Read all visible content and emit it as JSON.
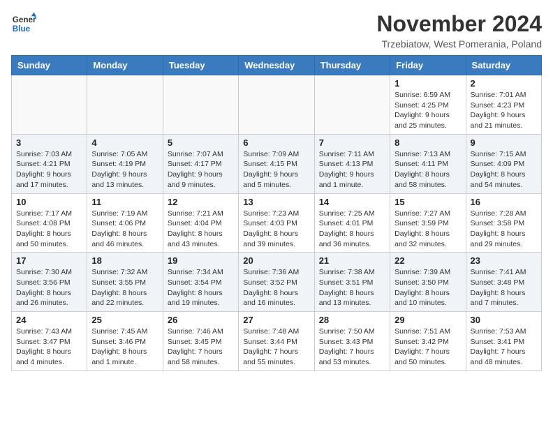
{
  "header": {
    "logo_line1": "General",
    "logo_line2": "Blue",
    "month_title": "November 2024",
    "subtitle": "Trzebiatow, West Pomerania, Poland"
  },
  "days_of_week": [
    "Sunday",
    "Monday",
    "Tuesday",
    "Wednesday",
    "Thursday",
    "Friday",
    "Saturday"
  ],
  "weeks": [
    [
      {
        "day": "",
        "info": ""
      },
      {
        "day": "",
        "info": ""
      },
      {
        "day": "",
        "info": ""
      },
      {
        "day": "",
        "info": ""
      },
      {
        "day": "",
        "info": ""
      },
      {
        "day": "1",
        "info": "Sunrise: 6:59 AM\nSunset: 4:25 PM\nDaylight: 9 hours\nand 25 minutes."
      },
      {
        "day": "2",
        "info": "Sunrise: 7:01 AM\nSunset: 4:23 PM\nDaylight: 9 hours\nand 21 minutes."
      }
    ],
    [
      {
        "day": "3",
        "info": "Sunrise: 7:03 AM\nSunset: 4:21 PM\nDaylight: 9 hours\nand 17 minutes."
      },
      {
        "day": "4",
        "info": "Sunrise: 7:05 AM\nSunset: 4:19 PM\nDaylight: 9 hours\nand 13 minutes."
      },
      {
        "day": "5",
        "info": "Sunrise: 7:07 AM\nSunset: 4:17 PM\nDaylight: 9 hours\nand 9 minutes."
      },
      {
        "day": "6",
        "info": "Sunrise: 7:09 AM\nSunset: 4:15 PM\nDaylight: 9 hours\nand 5 minutes."
      },
      {
        "day": "7",
        "info": "Sunrise: 7:11 AM\nSunset: 4:13 PM\nDaylight: 9 hours\nand 1 minute."
      },
      {
        "day": "8",
        "info": "Sunrise: 7:13 AM\nSunset: 4:11 PM\nDaylight: 8 hours\nand 58 minutes."
      },
      {
        "day": "9",
        "info": "Sunrise: 7:15 AM\nSunset: 4:09 PM\nDaylight: 8 hours\nand 54 minutes."
      }
    ],
    [
      {
        "day": "10",
        "info": "Sunrise: 7:17 AM\nSunset: 4:08 PM\nDaylight: 8 hours\nand 50 minutes."
      },
      {
        "day": "11",
        "info": "Sunrise: 7:19 AM\nSunset: 4:06 PM\nDaylight: 8 hours\nand 46 minutes."
      },
      {
        "day": "12",
        "info": "Sunrise: 7:21 AM\nSunset: 4:04 PM\nDaylight: 8 hours\nand 43 minutes."
      },
      {
        "day": "13",
        "info": "Sunrise: 7:23 AM\nSunset: 4:03 PM\nDaylight: 8 hours\nand 39 minutes."
      },
      {
        "day": "14",
        "info": "Sunrise: 7:25 AM\nSunset: 4:01 PM\nDaylight: 8 hours\nand 36 minutes."
      },
      {
        "day": "15",
        "info": "Sunrise: 7:27 AM\nSunset: 3:59 PM\nDaylight: 8 hours\nand 32 minutes."
      },
      {
        "day": "16",
        "info": "Sunrise: 7:28 AM\nSunset: 3:58 PM\nDaylight: 8 hours\nand 29 minutes."
      }
    ],
    [
      {
        "day": "17",
        "info": "Sunrise: 7:30 AM\nSunset: 3:56 PM\nDaylight: 8 hours\nand 26 minutes."
      },
      {
        "day": "18",
        "info": "Sunrise: 7:32 AM\nSunset: 3:55 PM\nDaylight: 8 hours\nand 22 minutes."
      },
      {
        "day": "19",
        "info": "Sunrise: 7:34 AM\nSunset: 3:54 PM\nDaylight: 8 hours\nand 19 minutes."
      },
      {
        "day": "20",
        "info": "Sunrise: 7:36 AM\nSunset: 3:52 PM\nDaylight: 8 hours\nand 16 minutes."
      },
      {
        "day": "21",
        "info": "Sunrise: 7:38 AM\nSunset: 3:51 PM\nDaylight: 8 hours\nand 13 minutes."
      },
      {
        "day": "22",
        "info": "Sunrise: 7:39 AM\nSunset: 3:50 PM\nDaylight: 8 hours\nand 10 minutes."
      },
      {
        "day": "23",
        "info": "Sunrise: 7:41 AM\nSunset: 3:48 PM\nDaylight: 8 hours\nand 7 minutes."
      }
    ],
    [
      {
        "day": "24",
        "info": "Sunrise: 7:43 AM\nSunset: 3:47 PM\nDaylight: 8 hours\nand 4 minutes."
      },
      {
        "day": "25",
        "info": "Sunrise: 7:45 AM\nSunset: 3:46 PM\nDaylight: 8 hours\nand 1 minute."
      },
      {
        "day": "26",
        "info": "Sunrise: 7:46 AM\nSunset: 3:45 PM\nDaylight: 7 hours\nand 58 minutes."
      },
      {
        "day": "27",
        "info": "Sunrise: 7:48 AM\nSunset: 3:44 PM\nDaylight: 7 hours\nand 55 minutes."
      },
      {
        "day": "28",
        "info": "Sunrise: 7:50 AM\nSunset: 3:43 PM\nDaylight: 7 hours\nand 53 minutes."
      },
      {
        "day": "29",
        "info": "Sunrise: 7:51 AM\nSunset: 3:42 PM\nDaylight: 7 hours\nand 50 minutes."
      },
      {
        "day": "30",
        "info": "Sunrise: 7:53 AM\nSunset: 3:41 PM\nDaylight: 7 hours\nand 48 minutes."
      }
    ]
  ]
}
